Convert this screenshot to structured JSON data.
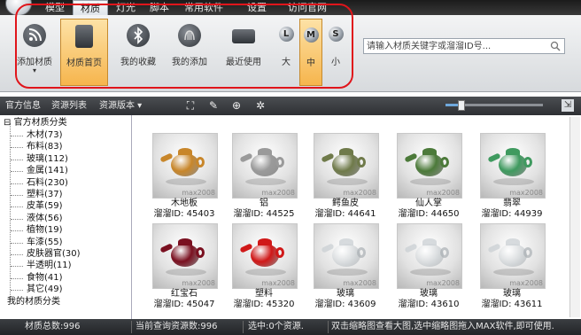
{
  "menu": {
    "tabs": [
      "模型",
      "材质",
      "灯光",
      "脚本",
      "常用软件",
      "设置",
      "访问官网"
    ],
    "active_tab": "材质"
  },
  "ribbon": {
    "buttons": [
      {
        "label": "添加材质",
        "icon": "rss-icon"
      },
      {
        "label": "材质首页",
        "icon": "home-tablet-icon"
      },
      {
        "label": "我的收藏",
        "icon": "bluetooth-icon"
      },
      {
        "label": "我的添加",
        "icon": "shell-icon"
      },
      {
        "label": "最近使用",
        "icon": "recent-icon"
      }
    ],
    "sizes": [
      {
        "letter": "L",
        "label": "大"
      },
      {
        "letter": "M",
        "label": "中"
      },
      {
        "letter": "S",
        "label": "小"
      }
    ],
    "search_placeholder": "请输入材质关键字或溜溜ID号..."
  },
  "toolbar": {
    "items": [
      "官方信息",
      "资源列表",
      "资源版本 ▾"
    ],
    "zoom_fraction": 0.15
  },
  "tree": {
    "root": "官方材质分类",
    "items": [
      "木材(73)",
      "布料(83)",
      "玻璃(112)",
      "金属(141)",
      "石料(230)",
      "塑料(37)",
      "皮革(59)",
      "液体(56)",
      "植物(19)",
      "车漆(55)",
      "皮肤器官(30)",
      "半透明(11)",
      "食物(41)",
      "其它(49)"
    ],
    "footer": "我的材质分类"
  },
  "materials": [
    {
      "name": "木地板",
      "id": "溜溜ID: 45403"
    },
    {
      "name": "铝",
      "id": "溜溜ID: 44525"
    },
    {
      "name": "鳄鱼皮",
      "id": "溜溜ID: 44641"
    },
    {
      "name": "仙人掌",
      "id": "溜溜ID: 44650"
    },
    {
      "name": "翡翠",
      "id": "溜溜ID: 44939"
    },
    {
      "name": "红宝石",
      "id": "溜溜ID: 45047"
    },
    {
      "name": "塑料",
      "id": "溜溜ID: 45320"
    },
    {
      "name": "玻璃",
      "id": "溜溜ID: 43609"
    },
    {
      "name": "玻璃",
      "id": "溜溜ID: 43610"
    },
    {
      "name": "玻璃",
      "id": "溜溜ID: 43611"
    }
  ],
  "watermark": "max2008",
  "status": {
    "total": "材质总数:996",
    "query": "当前查询资源数:996",
    "selected": "选中:0个资源.",
    "hint": "双击缩略图查看大图,选中缩略图拖入MAX软件,即可使用."
  },
  "colors": {
    "menu_bg": "#2a2a2a",
    "ribbon_active": "#f6b54d",
    "highlight_box": "#e0151b",
    "pot_colors": [
      "#c8862a",
      "#9a9a9a",
      "#6f7a4a",
      "#4c7a3a",
      "#3f9a5f",
      "#7a1020",
      "#d01818",
      "#cfd3d6",
      "#d8dbdd",
      "#dfe2e4"
    ]
  }
}
